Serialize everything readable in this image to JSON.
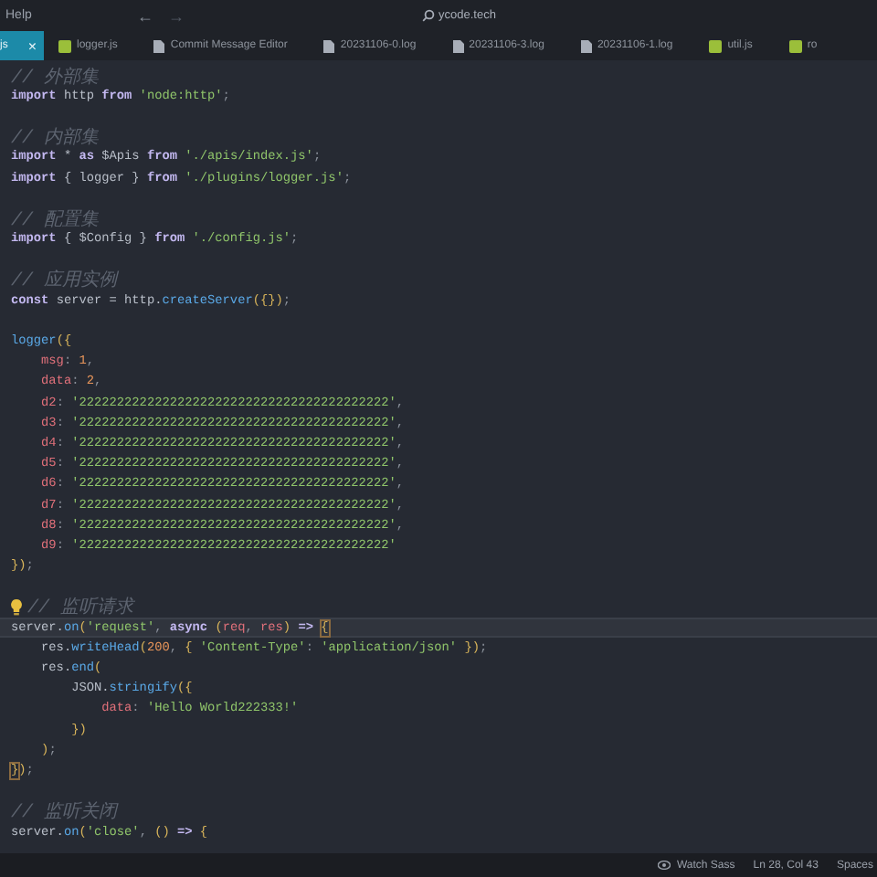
{
  "menu": {
    "label": "Help"
  },
  "nav": {
    "back": "←",
    "forward": "→"
  },
  "search": {
    "value": "ycode.tech"
  },
  "tabs": [
    {
      "label": "js",
      "selected": true,
      "close": "×"
    },
    {
      "label": "logger.js",
      "kind": "js",
      "selected": false
    },
    {
      "label": "Commit Message Editor",
      "kind": "doc",
      "selected": false
    },
    {
      "label": "20231106-0.log",
      "kind": "doc",
      "selected": false
    },
    {
      "label": "20231106-3.log",
      "kind": "doc",
      "selected": false
    },
    {
      "label": "20231106-1.log",
      "kind": "doc",
      "selected": false
    },
    {
      "label": "util.js",
      "kind": "js",
      "selected": false
    },
    {
      "label": "ro",
      "kind": "js",
      "selected": false
    }
  ],
  "code": [
    {
      "kind": "code",
      "tokens": [
        {
          "kind": "comment",
          "text": "// 外部集"
        }
      ]
    },
    {
      "kind": "code",
      "tokens": [
        {
          "kind": "keyword",
          "text": "import"
        },
        {
          "kind": "plain",
          "text": " http "
        },
        {
          "kind": "keyword",
          "text": "from"
        },
        {
          "kind": "string",
          "text": " 'node:http'"
        },
        {
          "kind": "punct",
          "text": ";"
        }
      ]
    },
    {
      "kind": "blank"
    },
    {
      "kind": "code",
      "tokens": [
        {
          "kind": "comment",
          "text": "// 内部集"
        }
      ]
    },
    {
      "kind": "code",
      "tokens": [
        {
          "kind": "keyword",
          "text": "import"
        },
        {
          "kind": "plain",
          "text": " * "
        },
        {
          "kind": "keyword",
          "text": "as"
        },
        {
          "kind": "plain",
          "text": " $Apis "
        },
        {
          "kind": "keyword",
          "text": "from"
        },
        {
          "kind": "string",
          "text": " './apis/index.js'"
        },
        {
          "kind": "punct",
          "text": ";"
        }
      ]
    },
    {
      "kind": "code",
      "tokens": [
        {
          "kind": "keyword",
          "text": "import"
        },
        {
          "kind": "plain",
          "text": " { logger } "
        },
        {
          "kind": "keyword",
          "text": "from"
        },
        {
          "kind": "string",
          "text": " './plugins/logger.js'"
        },
        {
          "kind": "punct",
          "text": ";"
        }
      ]
    },
    {
      "kind": "blank"
    },
    {
      "kind": "code",
      "tokens": [
        {
          "kind": "comment",
          "text": "// 配置集"
        }
      ]
    },
    {
      "kind": "code",
      "tokens": [
        {
          "kind": "keyword",
          "text": "import"
        },
        {
          "kind": "plain",
          "text": " { $Config } "
        },
        {
          "kind": "keyword",
          "text": "from"
        },
        {
          "kind": "string",
          "text": " './config.js'"
        },
        {
          "kind": "punct",
          "text": ";"
        }
      ]
    },
    {
      "kind": "blank"
    },
    {
      "kind": "code",
      "tokens": [
        {
          "kind": "comment",
          "text": "// 应用实例"
        }
      ]
    },
    {
      "kind": "code",
      "tokens": [
        {
          "kind": "keyword",
          "text": "const"
        },
        {
          "kind": "plain",
          "text": " server = http."
        },
        {
          "kind": "func",
          "text": "createServer"
        },
        {
          "kind": "bracket",
          "text": "({})"
        },
        {
          "kind": "punct",
          "text": ";"
        }
      ]
    },
    {
      "kind": "blank"
    },
    {
      "kind": "code",
      "tokens": [
        {
          "kind": "func",
          "text": "logger"
        },
        {
          "kind": "bracket",
          "text": "({"
        }
      ]
    },
    {
      "kind": "code",
      "tokens": [
        {
          "kind": "property",
          "text": "    msg"
        },
        {
          "kind": "punct",
          "text": ": "
        },
        {
          "kind": "number",
          "text": "1"
        },
        {
          "kind": "punct",
          "text": ","
        }
      ]
    },
    {
      "kind": "code",
      "tokens": [
        {
          "kind": "property",
          "text": "    data"
        },
        {
          "kind": "punct",
          "text": ": "
        },
        {
          "kind": "number",
          "text": "2"
        },
        {
          "kind": "punct",
          "text": ","
        }
      ]
    },
    {
      "kind": "code",
      "tokens": [
        {
          "kind": "property",
          "text": "    d2"
        },
        {
          "kind": "punct",
          "text": ": "
        },
        {
          "kind": "string",
          "text": "'22222222222222222222222222222222222222222'"
        },
        {
          "kind": "punct",
          "text": ","
        }
      ]
    },
    {
      "kind": "code",
      "tokens": [
        {
          "kind": "property",
          "text": "    d3"
        },
        {
          "kind": "punct",
          "text": ": "
        },
        {
          "kind": "string",
          "text": "'22222222222222222222222222222222222222222'"
        },
        {
          "kind": "punct",
          "text": ","
        }
      ]
    },
    {
      "kind": "code",
      "tokens": [
        {
          "kind": "property",
          "text": "    d4"
        },
        {
          "kind": "punct",
          "text": ": "
        },
        {
          "kind": "string",
          "text": "'22222222222222222222222222222222222222222'"
        },
        {
          "kind": "punct",
          "text": ","
        }
      ]
    },
    {
      "kind": "code",
      "tokens": [
        {
          "kind": "property",
          "text": "    d5"
        },
        {
          "kind": "punct",
          "text": ": "
        },
        {
          "kind": "string",
          "text": "'22222222222222222222222222222222222222222'"
        },
        {
          "kind": "punct",
          "text": ","
        }
      ]
    },
    {
      "kind": "code",
      "tokens": [
        {
          "kind": "property",
          "text": "    d6"
        },
        {
          "kind": "punct",
          "text": ": "
        },
        {
          "kind": "string",
          "text": "'22222222222222222222222222222222222222222'"
        },
        {
          "kind": "punct",
          "text": ","
        }
      ]
    },
    {
      "kind": "code",
      "tokens": [
        {
          "kind": "property",
          "text": "    d7"
        },
        {
          "kind": "punct",
          "text": ": "
        },
        {
          "kind": "string",
          "text": "'22222222222222222222222222222222222222222'"
        },
        {
          "kind": "punct",
          "text": ","
        }
      ]
    },
    {
      "kind": "code",
      "tokens": [
        {
          "kind": "property",
          "text": "    d8"
        },
        {
          "kind": "punct",
          "text": ": "
        },
        {
          "kind": "string",
          "text": "'22222222222222222222222222222222222222222'"
        },
        {
          "kind": "punct",
          "text": ","
        }
      ]
    },
    {
      "kind": "code",
      "tokens": [
        {
          "kind": "property",
          "text": "    d9"
        },
        {
          "kind": "punct",
          "text": ": "
        },
        {
          "kind": "string",
          "text": "'22222222222222222222222222222222222222222'"
        }
      ]
    },
    {
      "kind": "code",
      "tokens": [
        {
          "kind": "bracket",
          "text": "})"
        },
        {
          "kind": "punct",
          "text": ";"
        }
      ]
    },
    {
      "kind": "blank"
    },
    {
      "kind": "code",
      "bulb": true,
      "tokens": [
        {
          "kind": "comment",
          "text": "// 监听请求"
        }
      ]
    },
    {
      "kind": "code",
      "current": true,
      "tokens": [
        {
          "kind": "plain",
          "text": "server."
        },
        {
          "kind": "func",
          "text": "on"
        },
        {
          "kind": "bracket",
          "text": "("
        },
        {
          "kind": "string",
          "text": "'request'"
        },
        {
          "kind": "punct",
          "text": ", "
        },
        {
          "kind": "keyword",
          "text": "async "
        },
        {
          "kind": "bracket",
          "text": "("
        },
        {
          "kind": "property",
          "text": "req"
        },
        {
          "kind": "punct",
          "text": ", "
        },
        {
          "kind": "property",
          "text": "res"
        },
        {
          "kind": "bracket",
          "text": ") "
        },
        {
          "kind": "keyword",
          "text": "=> "
        },
        {
          "kind": "match",
          "text": "{"
        }
      ]
    },
    {
      "kind": "code",
      "tokens": [
        {
          "kind": "plain",
          "text": "    res."
        },
        {
          "kind": "func",
          "text": "writeHead"
        },
        {
          "kind": "bracket",
          "text": "("
        },
        {
          "kind": "number",
          "text": "200"
        },
        {
          "kind": "punct",
          "text": ", "
        },
        {
          "kind": "bracket",
          "text": "{ "
        },
        {
          "kind": "string",
          "text": "'Content-Type'"
        },
        {
          "kind": "punct",
          "text": ": "
        },
        {
          "kind": "string",
          "text": "'application/json' "
        },
        {
          "kind": "bracket",
          "text": "})"
        },
        {
          "kind": "punct",
          "text": ";"
        }
      ]
    },
    {
      "kind": "code",
      "tokens": [
        {
          "kind": "plain",
          "text": "    res."
        },
        {
          "kind": "func",
          "text": "end"
        },
        {
          "kind": "bracket",
          "text": "("
        }
      ]
    },
    {
      "kind": "code",
      "tokens": [
        {
          "kind": "plain",
          "text": "        JSON."
        },
        {
          "kind": "func",
          "text": "stringify"
        },
        {
          "kind": "bracket",
          "text": "({"
        }
      ]
    },
    {
      "kind": "code",
      "tokens": [
        {
          "kind": "property",
          "text": "            data"
        },
        {
          "kind": "punct",
          "text": ": "
        },
        {
          "kind": "string",
          "text": "'Hello World222333!'"
        }
      ]
    },
    {
      "kind": "code",
      "tokens": [
        {
          "kind": "bracket",
          "text": "        })"
        }
      ]
    },
    {
      "kind": "code",
      "tokens": [
        {
          "kind": "bracket",
          "text": "    )"
        },
        {
          "kind": "punct",
          "text": ";"
        }
      ]
    },
    {
      "kind": "code",
      "tokens": [
        {
          "kind": "match",
          "text": "}"
        },
        {
          "kind": "bracket",
          "text": ")"
        },
        {
          "kind": "punct",
          "text": ";"
        }
      ]
    },
    {
      "kind": "blank"
    },
    {
      "kind": "code",
      "tokens": [
        {
          "kind": "comment",
          "text": "// 监听关闭"
        }
      ]
    },
    {
      "kind": "code",
      "tokens": [
        {
          "kind": "plain",
          "text": "server."
        },
        {
          "kind": "func",
          "text": "on"
        },
        {
          "kind": "bracket",
          "text": "("
        },
        {
          "kind": "string",
          "text": "'close'"
        },
        {
          "kind": "punct",
          "text": ", "
        },
        {
          "kind": "bracket",
          "text": "() "
        },
        {
          "kind": "keyword",
          "text": "=> "
        },
        {
          "kind": "bracket",
          "text": "{"
        }
      ]
    }
  ],
  "status_bar": {
    "watch": "Watch Sass",
    "position": "Ln 28, Col 43",
    "spaces": "Spaces"
  }
}
